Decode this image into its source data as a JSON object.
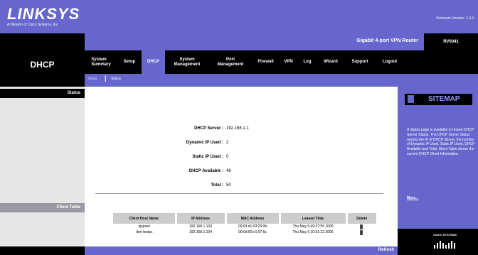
{
  "header": {
    "logo": "LINKSYS",
    "logo_sub": "A Division of Cisco Systems, Inc.",
    "firmware": "Firmware Version: 1.3.3",
    "product": "Gigabit 4-port VPN Router",
    "model": "RV0041"
  },
  "section_title": "DHCP",
  "nav": [
    {
      "label": "System\nSummary",
      "active": false
    },
    {
      "label": "Setup",
      "active": false
    },
    {
      "label": "DHCP",
      "active": true
    },
    {
      "label": "System\nManagement",
      "active": false
    },
    {
      "label": "Port\nManagement",
      "active": false
    },
    {
      "label": "Firewall",
      "active": false
    },
    {
      "label": "VPN",
      "active": false
    },
    {
      "label": "Log",
      "active": false
    },
    {
      "label": "Wizard",
      "active": false
    },
    {
      "label": "Support",
      "active": false
    },
    {
      "label": "Logout",
      "active": false
    }
  ],
  "subnav": {
    "setup": "Setup",
    "status": "Status",
    "separator": "|"
  },
  "left": {
    "status": "Status",
    "client_table": "Client Table"
  },
  "status": {
    "dhcp_server_label": "DHCP Server :",
    "dhcp_server_value": "192.168.1.1",
    "dynamic_ip_label": "Dynamic IP Used :",
    "dynamic_ip_value": "2",
    "static_ip_label": "Static IP Used :",
    "static_ip_value": "0",
    "available_label": "DHCP Available :",
    "available_value": "48",
    "total_label": "Total :",
    "total_value": "50"
  },
  "client_table": {
    "headers": [
      "Client Host Name",
      "IP Address",
      "MAC Address",
      "Leased Time",
      "Delete"
    ],
    "rows": [
      {
        "host": "sjsjrasc",
        "ip": "192.168.1.103",
        "mac": "00:03:d1:03:20:0b",
        "leased": "Thu May 5 09:37:55 2005"
      },
      {
        "host": "ibm-testpc",
        "ip": "192.168.1.104",
        "mac": "00:0d:60:e1:07:5c",
        "leased": "Thu May 5 10:51:22 2005"
      }
    ]
  },
  "refresh_label": "Refresh",
  "sitemap": {
    "title": "SITEMAP",
    "help": "A Status page is available to review DHCP Server Status. The DHCP Server Status reports the IP of DHCP Server, the number of Dynamic IP Used, Static IP Used, DHCP Available and Total. Client Table shows the current DHCP Client Information.",
    "more": "More...",
    "cisco": "CISCO SYSTEMS"
  },
  "colors": {
    "accent": "#6666cc",
    "black": "#000000",
    "gray": "#e6e6e6"
  }
}
